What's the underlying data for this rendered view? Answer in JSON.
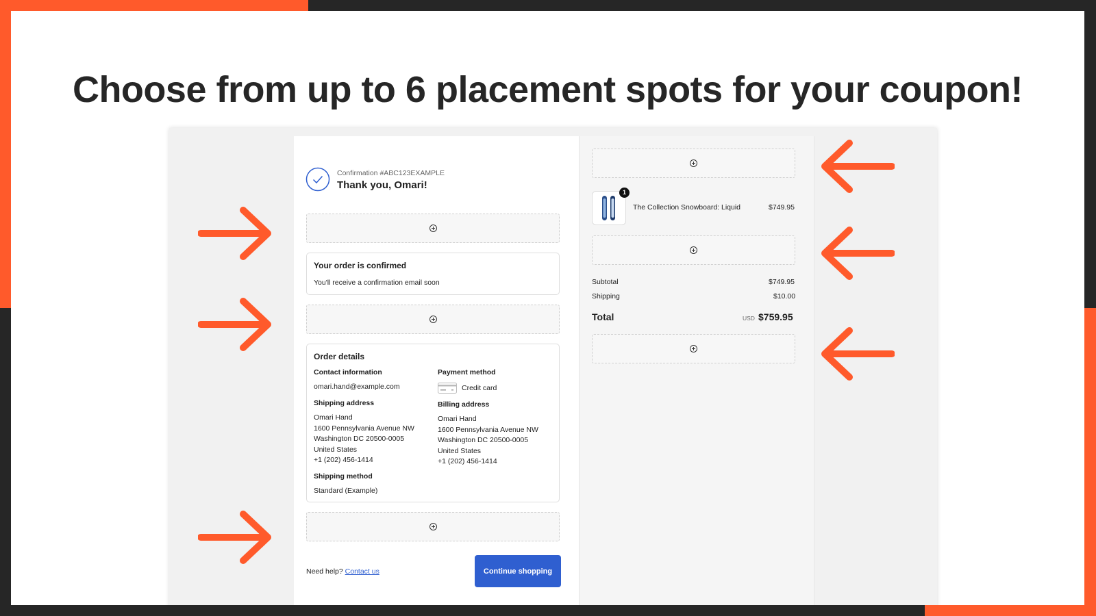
{
  "colors": {
    "accent": "#ff5a2b",
    "dark": "#262626",
    "button": "#2f5fd0"
  },
  "headline": "Choose from up to 6 placement spots for your coupon!",
  "confirmation": {
    "number": "Confirmation #ABC123EXAMPLE",
    "thanks": "Thank you, Omari!"
  },
  "order_confirmed": {
    "title": "Your order is confirmed",
    "message": "You'll receive a confirmation email soon"
  },
  "order_details": {
    "title": "Order details",
    "contact_label": "Contact information",
    "contact_email": "omari.hand@example.com",
    "shipping_address_label": "Shipping address",
    "shipping_address": [
      "Omari Hand",
      "1600 Pennsylvania Avenue NW",
      "Washington DC 20500-0005",
      "United States",
      "+1 (202) 456-1414"
    ],
    "shipping_method_label": "Shipping method",
    "shipping_method": "Standard (Example)",
    "payment_label": "Payment method",
    "payment_value": "Credit card",
    "billing_address_label": "Billing address",
    "billing_address": [
      "Omari Hand",
      "1600 Pennsylvania Avenue NW",
      "Washington DC 20500-0005",
      "United States",
      "+1 (202) 456-1414"
    ]
  },
  "footer": {
    "help_text": "Need help?",
    "contact_link": "Contact us",
    "continue_button": "Continue shopping"
  },
  "summary": {
    "item_name": "The Collection Snowboard: Liquid",
    "item_price": "$749.95",
    "item_qty": "1",
    "subtotal_label": "Subtotal",
    "subtotal": "$749.95",
    "shipping_label": "Shipping",
    "shipping": "$10.00",
    "total_label": "Total",
    "currency": "USD",
    "total": "$759.95"
  },
  "icons": {
    "placement": "add-circle-icon",
    "confirmation": "check-circle-icon",
    "arrow": "arrow-icon",
    "card": "credit-card-icon"
  }
}
